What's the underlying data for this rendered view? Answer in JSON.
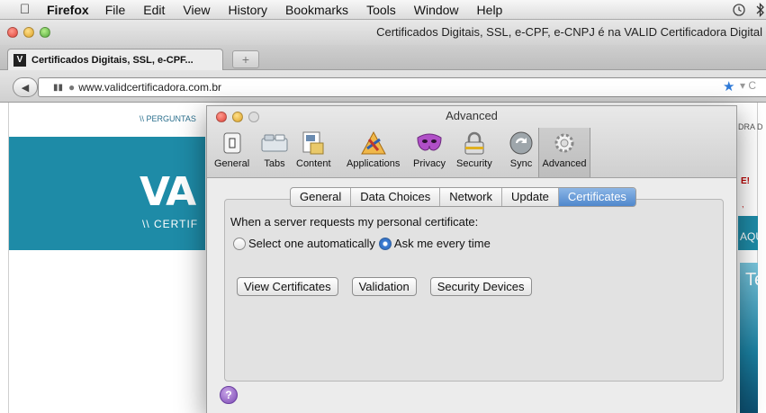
{
  "menubar": {
    "app": "Firefox",
    "items": [
      "File",
      "Edit",
      "View",
      "History",
      "Bookmarks",
      "Tools",
      "Window",
      "Help"
    ]
  },
  "window": {
    "title": "Certificados Digitais, SSL, e-CPF, e-CNPJ é na VALID Certificadora Digital"
  },
  "tab": {
    "title": "Certificados Digitais, SSL, e-CPF...",
    "new_tab": "+"
  },
  "navbar": {
    "url": "www.validcertificadora.com.br"
  },
  "page_behind": {
    "perguntas": "\\\\ PERGUNTAS",
    "ora": "DRA D",
    "logo": "VA",
    "certif": "\\\\ CERTIF",
    "excl": "E!",
    "comma": ",",
    "aqu": "AQU",
    "te": "Te"
  },
  "prefs": {
    "title": "Advanced",
    "toolbar": [
      {
        "label": "General",
        "icon": "switch-icon"
      },
      {
        "label": "Tabs",
        "icon": "tabs-icon"
      },
      {
        "label": "Content",
        "icon": "content-icon"
      },
      {
        "label": "Applications",
        "icon": "applications-icon"
      },
      {
        "label": "Privacy",
        "icon": "mask-icon"
      },
      {
        "label": "Security",
        "icon": "lock-icon"
      },
      {
        "label": "Sync",
        "icon": "sync-icon"
      },
      {
        "label": "Advanced",
        "icon": "gear-icon"
      }
    ],
    "tabs": [
      "General",
      "Data Choices",
      "Network",
      "Update",
      "Certificates"
    ],
    "selected_tab": "Certificates",
    "prompt": "When a server requests my personal certificate:",
    "radio_auto": "Select one automatically",
    "radio_ask": "Ask me every time",
    "selected_radio": "Ask me every time",
    "buttons": [
      "View Certificates",
      "Validation",
      "Security Devices"
    ],
    "help": "?"
  },
  "colors": {
    "brand_teal": "#1e8ba7",
    "selection_blue": "#4f87cc"
  }
}
